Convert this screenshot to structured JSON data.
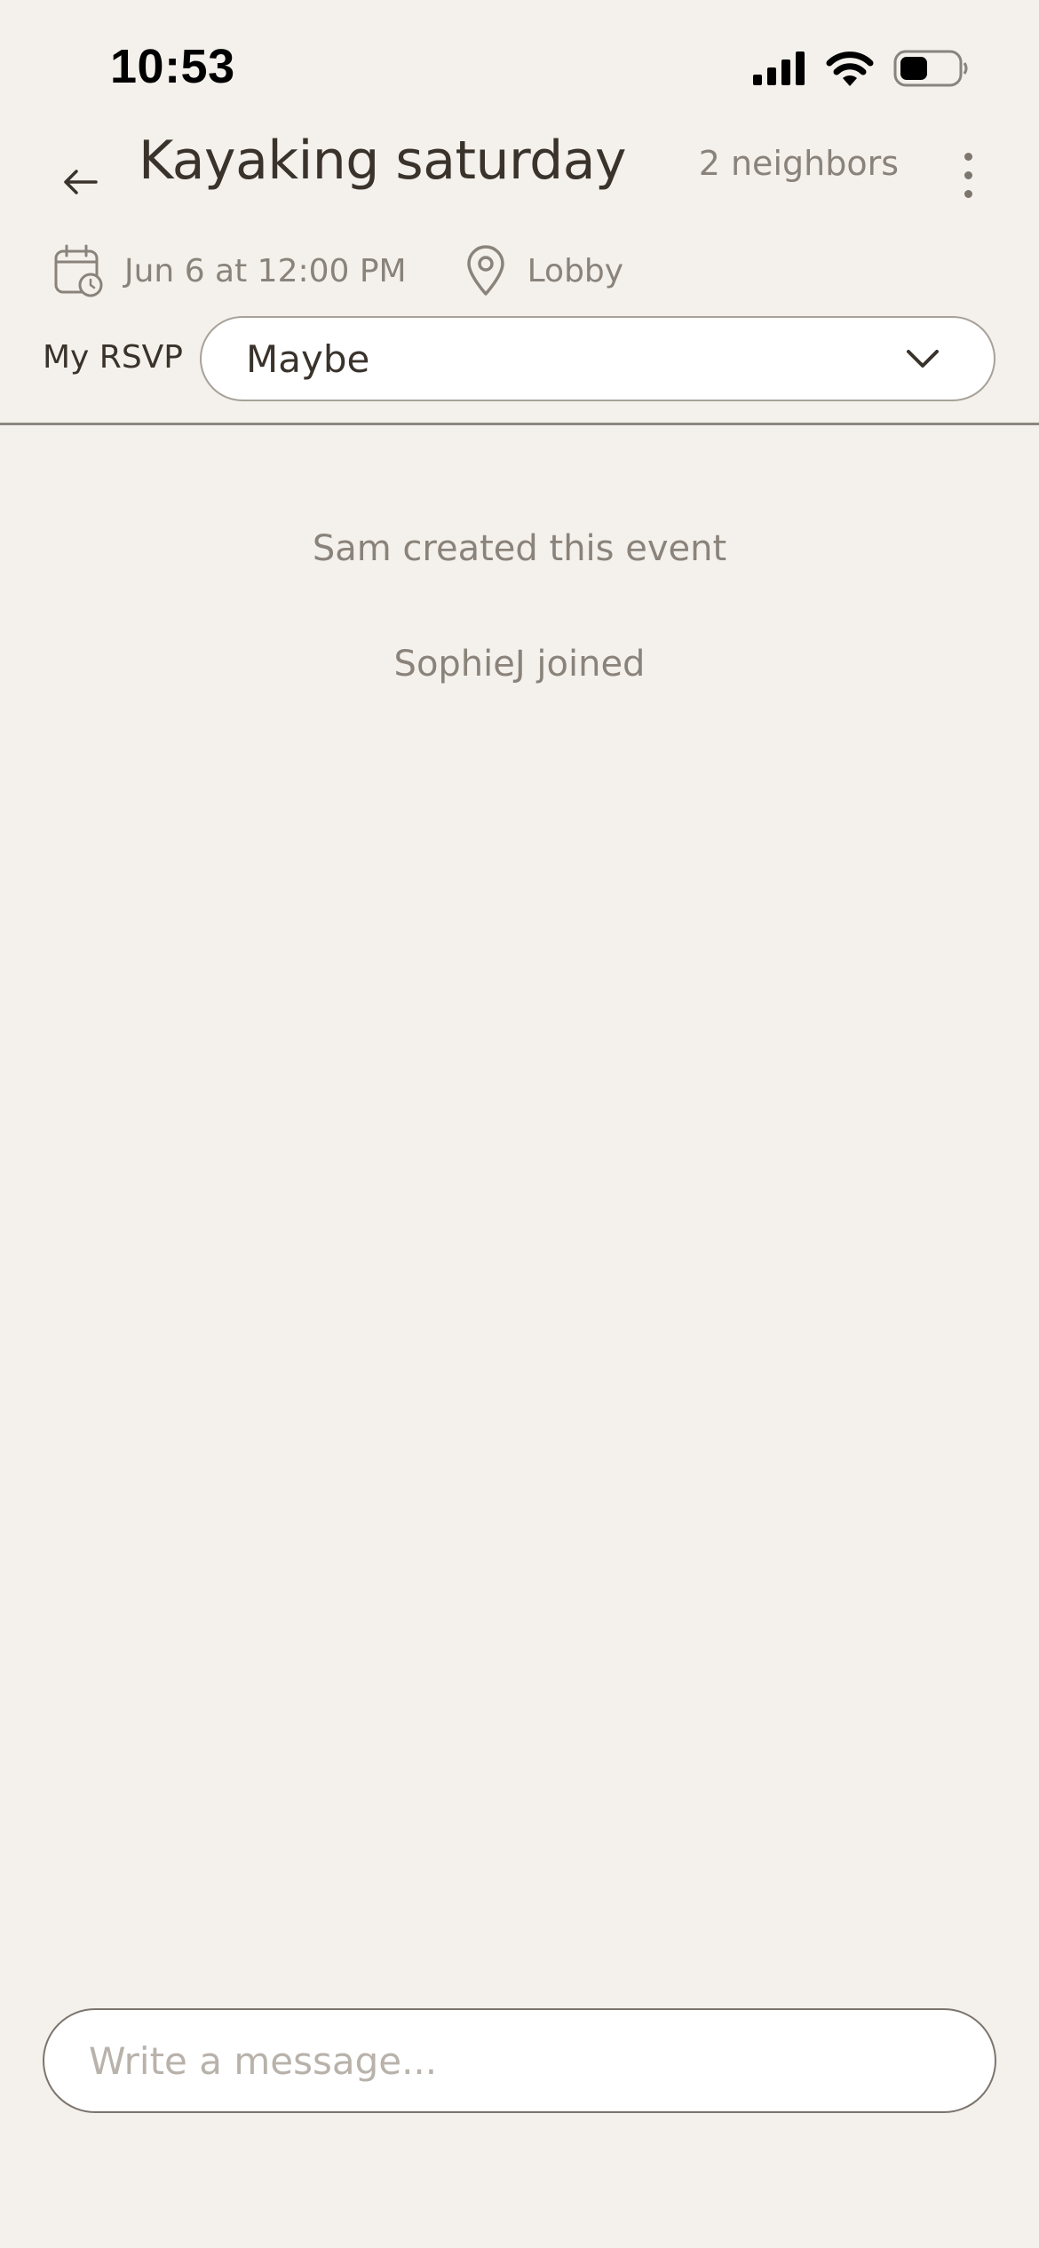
{
  "status_bar": {
    "time": "10:53"
  },
  "header": {
    "title": "Kayaking saturday",
    "neighbors": "2 neighbors",
    "datetime": "Jun 6 at 12:00 PM",
    "location": "Lobby"
  },
  "rsvp": {
    "label": "My RSVP",
    "selected": "Maybe"
  },
  "feed": [
    "Sam created this event",
    "SophieJ joined"
  ],
  "composer": {
    "placeholder": "Write a message..."
  },
  "colors": {
    "background": "#f4f0eb",
    "text_primary": "#3a332c",
    "text_secondary": "#8a837b",
    "border": "#a7a199"
  }
}
